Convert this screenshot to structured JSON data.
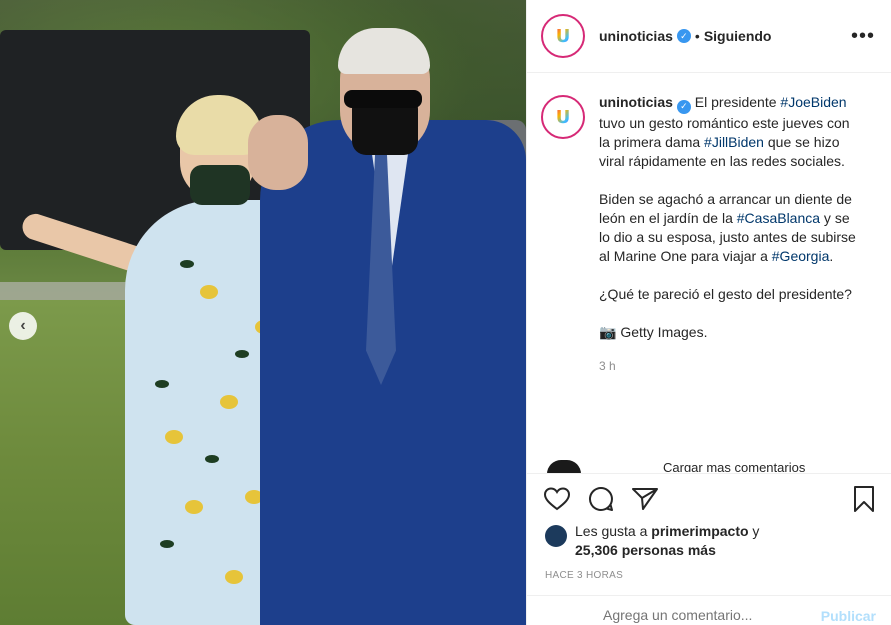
{
  "post": {
    "username": "uninoticias",
    "follow_status": "Siguiendo",
    "separator": "•",
    "more_icon": "more-options-icon",
    "avatar_logo_text": "U"
  },
  "caption": {
    "username": "uninoticias",
    "line1_a": "El presidente ",
    "tag_joebiden": "#JoeBiden",
    "line1_b": " tuvo un gesto romántico este jueves con la primera dama ",
    "tag_jillbiden": "#JillBiden",
    "line1_c": " que se hizo viral rápidamente en las redes sociales.",
    "para2_a": "Biden se agachó a arrancar un diente de león en el jardín de la ",
    "tag_casablanca": "#CasaBlanca",
    "para2_b": " y se lo dio a su esposa, justo antes de subirse al Marine One para viajar a ",
    "tag_georgia": "#Georgia",
    "para2_c": ".",
    "para3": "¿Qué te pareció el gesto del presidente?",
    "camera_emoji": "📷",
    "credit": "Getty Images.",
    "time": "3 h"
  },
  "next_comment_peek": "Cargar mas comentarios",
  "actions": {
    "like_icon": "heart-icon",
    "comment_icon": "comment-icon",
    "share_icon": "share-icon",
    "save_icon": "bookmark-icon"
  },
  "likes": {
    "prefix": "Les gusta a ",
    "user": "primerimpacto",
    "suffix": " y",
    "count": "25,306 personas más"
  },
  "posted_ago": "HACE 3 HORAS",
  "comment": {
    "placeholder": "Agrega un comentario...",
    "publish": "Publicar"
  },
  "carousel": {
    "prev_arrow": "‹"
  },
  "colors": {
    "link": "#00376b",
    "verified": "#3897f0",
    "border": "#efefef",
    "muted": "#8e8e8e"
  }
}
